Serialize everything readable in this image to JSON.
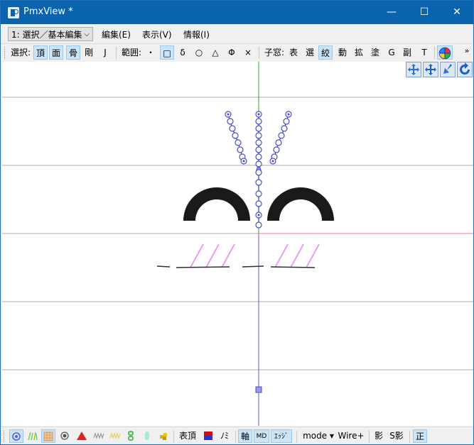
{
  "window": {
    "title": "PmxView *",
    "minimize": "—",
    "maximize": "☐",
    "close": "✕"
  },
  "menubar": {
    "mode_select": "1: 選択／基本編集",
    "items": [
      "編集(E)",
      "表示(V)",
      "情報(I)"
    ]
  },
  "toolbar": {
    "select_label": "選択:",
    "select_buttons": [
      "頂",
      "面",
      "骨",
      "剛",
      "J"
    ],
    "range_label": "範囲:",
    "range_buttons": [
      "・",
      "□",
      "δ",
      "○",
      "△",
      "Φ",
      "×"
    ],
    "child_label": "子窓:",
    "child_buttons": [
      "表",
      "選",
      "絞",
      "動",
      "拡",
      "塗",
      "G",
      "副",
      "T"
    ],
    "overflow": "»"
  },
  "statusbar": {
    "vertex_label": "表頂",
    "nomi_label": "ﾉﾐ",
    "axis_label": "軸",
    "md_label": "MD",
    "edge_label": "ｴｯｼﾞ",
    "mode_label": "mode ▾",
    "wire_label": "Wire+",
    "shadow_label": "影",
    "sshadow_label": "S影",
    "ortho_label": "正"
  },
  "colors": {
    "titlebar": "#0a64ad",
    "accent_selected": "#cce4f7",
    "bone": "#4a4ad0",
    "axis_x": "#ff7a90",
    "axis_y": "#2e9e2e",
    "axis_z": "#5a5ad8"
  }
}
